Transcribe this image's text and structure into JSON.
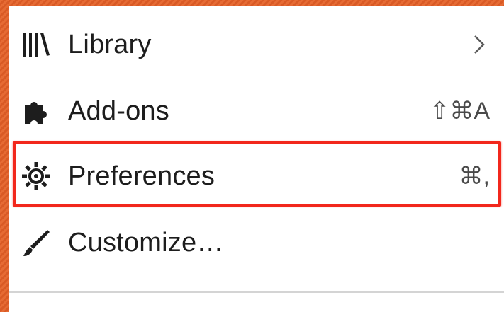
{
  "menu": {
    "items": [
      {
        "label": "Library",
        "shortcut": "",
        "icon": "library-icon",
        "has_submenu": true
      },
      {
        "label": "Add-ons",
        "shortcut": "⇧⌘A",
        "icon": "puzzle-icon"
      },
      {
        "label": "Preferences",
        "shortcut": "⌘,",
        "icon": "gear-icon",
        "highlighted": true
      },
      {
        "label": "Customize…",
        "shortcut": "",
        "icon": "brush-icon"
      }
    ]
  },
  "colors": {
    "background": "#e1642f",
    "highlight_border": "#f2271c",
    "menu_bg": "#ffffff",
    "text": "#1d1d1d"
  }
}
